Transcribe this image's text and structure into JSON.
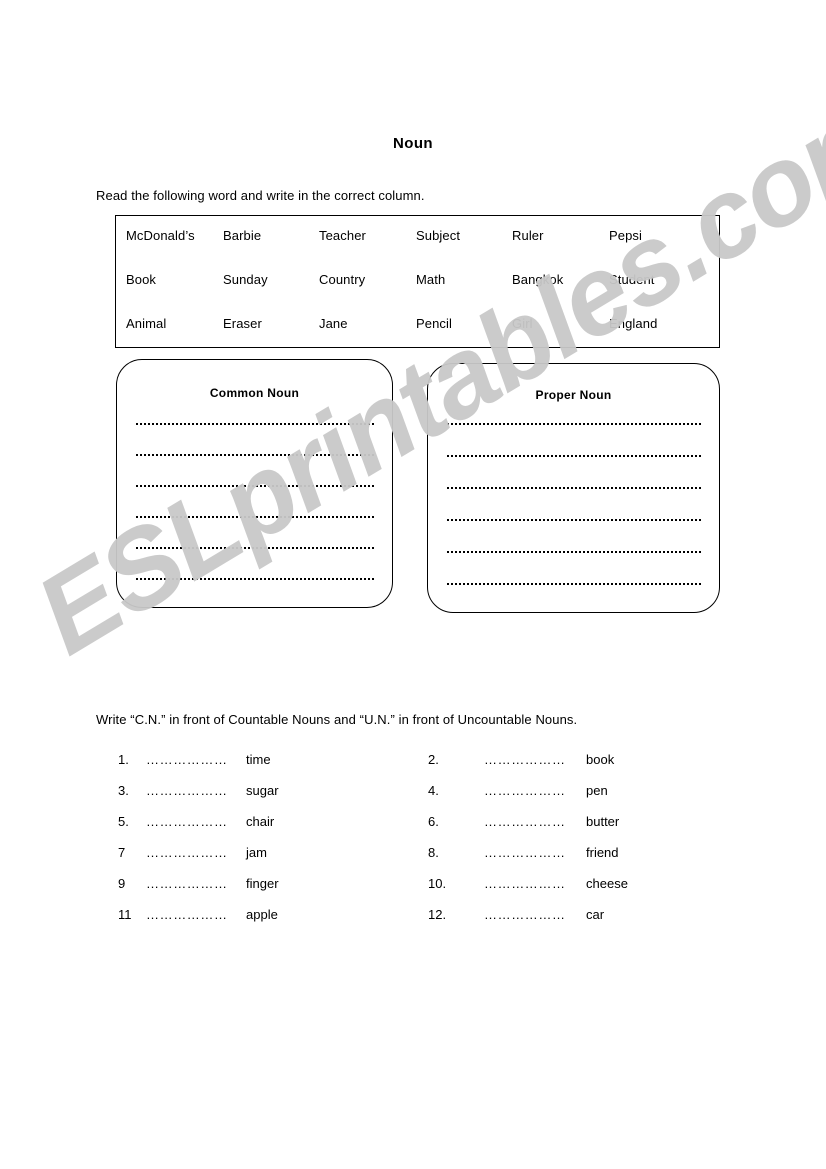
{
  "document": {
    "title": "Noun",
    "watermark": "ESLprintables.com",
    "watermark_color": "#c9c9c9"
  },
  "section_one": {
    "instruction": "Read the following word and write in the correct column.",
    "word_bank": {
      "rows": [
        [
          "McDonald’s",
          "Barbie",
          "Teacher",
          "Subject",
          "Ruler",
          "Pepsi"
        ],
        [
          "Book",
          "Sunday",
          "Country",
          "Math",
          "Bangkok",
          "Student"
        ],
        [
          "Animal",
          "Eraser",
          "Jane",
          "Pencil",
          "Girl",
          "England"
        ]
      ]
    },
    "columns": [
      {
        "heading": "Common Noun",
        "line_count": 6
      },
      {
        "heading": "Proper Noun",
        "line_count": 6
      }
    ]
  },
  "section_two": {
    "instruction": "Write “C.N.” in front of Countable Nouns and “U.N.” in front of Uncountable Nouns.",
    "blank": "………………",
    "items": [
      {
        "number": "1.",
        "word": "time"
      },
      {
        "number": "2.",
        "word": "book"
      },
      {
        "number": "3.",
        "word": "sugar"
      },
      {
        "number": "4.",
        "word": "pen"
      },
      {
        "number": "5.",
        "word": "chair"
      },
      {
        "number": "6.",
        "word": "butter"
      },
      {
        "number": "7",
        "word": "jam"
      },
      {
        "number": "8.",
        "word": "friend"
      },
      {
        "number": "9",
        "word": "finger"
      },
      {
        "number": "10.",
        "word": "cheese"
      },
      {
        "number": "11",
        "word": "apple"
      },
      {
        "number": "12.",
        "word": "car"
      }
    ]
  }
}
